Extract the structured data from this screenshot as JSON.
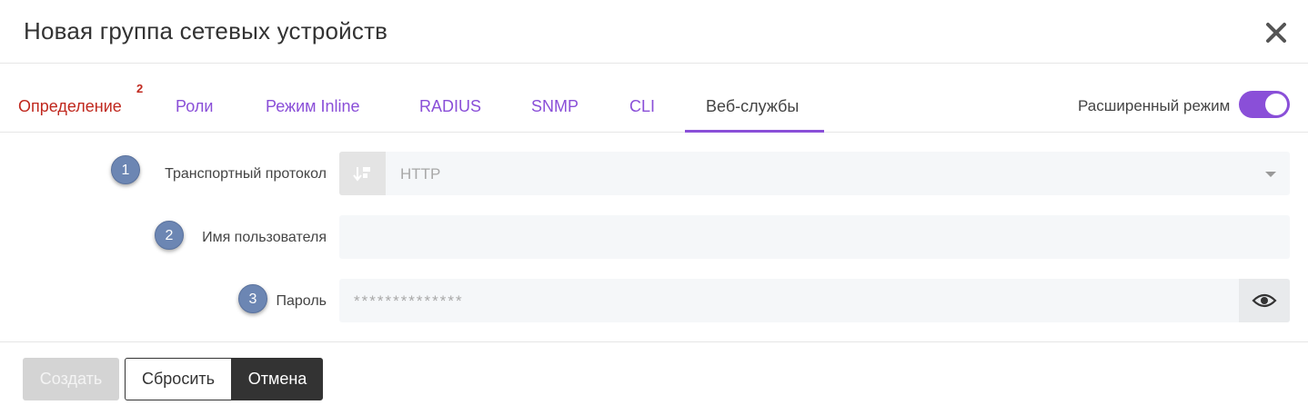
{
  "dialog": {
    "title": "Новая группа сетевых устройств",
    "close_icon": "close-icon"
  },
  "tabs": [
    {
      "label": "Определение",
      "state": "error",
      "badge": "2"
    },
    {
      "label": "Роли",
      "state": "normal"
    },
    {
      "label": "Режим Inline",
      "state": "normal"
    },
    {
      "label": "RADIUS",
      "state": "normal"
    },
    {
      "label": "SNMP",
      "state": "normal"
    },
    {
      "label": "CLI",
      "state": "normal"
    },
    {
      "label": "Веб-службы",
      "state": "active"
    }
  ],
  "advanced_mode": {
    "label": "Расширенный режим",
    "enabled": true
  },
  "form": {
    "transport": {
      "step": "1",
      "label": "Транспортный протокол",
      "value": "HTTP",
      "icon": "sort-icon"
    },
    "username": {
      "step": "2",
      "label": "Имя пользователя",
      "value": ""
    },
    "password": {
      "step": "3",
      "label": "Пароль",
      "placeholder": "**************",
      "icon": "eye-icon"
    }
  },
  "footer": {
    "create_label": "Создать",
    "reset_label": "Сбросить",
    "cancel_label": "Отмена"
  },
  "colors": {
    "accent": "#8a4fd8",
    "error": "#c0281e",
    "step_circle": "#6c86b3",
    "dark_button": "#333333"
  }
}
